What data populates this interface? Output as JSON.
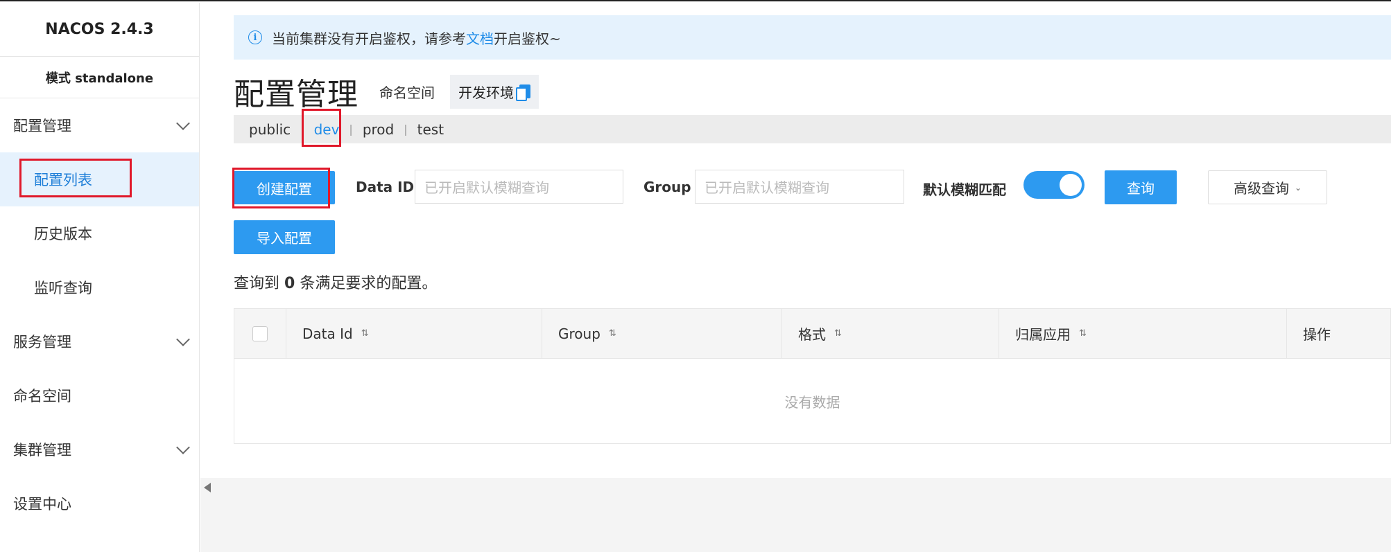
{
  "app": {
    "logo": "NACOS 2.4.3",
    "mode": "模式 standalone"
  },
  "sidebar": {
    "items": [
      {
        "label": "配置管理",
        "expandable": true
      },
      {
        "label": "配置列表",
        "sub": true,
        "active": true
      },
      {
        "label": "历史版本",
        "sub": true
      },
      {
        "label": "监听查询",
        "sub": true
      },
      {
        "label": "服务管理",
        "expandable": true
      },
      {
        "label": "命名空间"
      },
      {
        "label": "集群管理",
        "expandable": true
      },
      {
        "label": "设置中心"
      }
    ]
  },
  "alert": {
    "prefix": "当前集群没有开启鉴权，请参考",
    "link": "文档",
    "suffix": "开启鉴权~",
    "icon": "info-icon"
  },
  "header": {
    "title": "配置管理",
    "namespace_label": "命名空间",
    "namespace_value": "开发环境",
    "copy_icon": "copy-icon"
  },
  "namespaces": {
    "tabs": [
      "public",
      "dev",
      "prod",
      "test"
    ],
    "active": "dev",
    "separator": "|"
  },
  "toolbar": {
    "create_label": "创建配置",
    "import_label": "导入配置",
    "dataid_label": "Data ID",
    "dataid_placeholder": "已开启默认模糊查询",
    "group_label": "Group",
    "group_placeholder": "已开启默认模糊查询",
    "fuzzy_label": "默认模糊匹配",
    "fuzzy_on": true,
    "search_label": "查询",
    "advanced_label": "高级查询",
    "advanced_caret": "⌄"
  },
  "result": {
    "prefix": "查询到",
    "count": "0",
    "suffix": "条满足要求的配置。"
  },
  "table": {
    "columns": [
      "Data Id",
      "Group",
      "格式",
      "归属应用",
      "操作"
    ],
    "sort_glyph": "⇅",
    "empty_text": "没有数据",
    "rows": []
  },
  "colors": {
    "primary": "#2d9af0",
    "link": "#1f8ce8",
    "alert_bg": "#e5f2fd",
    "active_bg": "#e6f2fd",
    "highlight": "#e0182a"
  }
}
